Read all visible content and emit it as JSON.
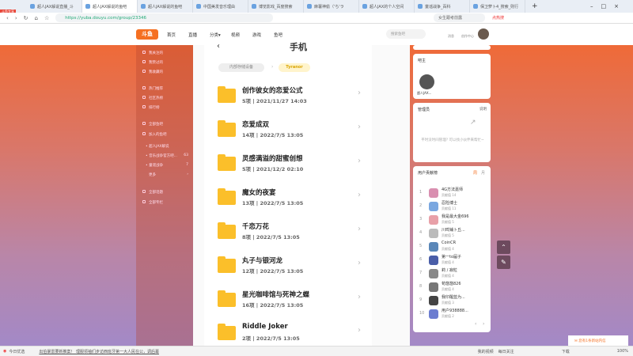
{
  "browser": {
    "tabs": [
      "超人JAX解说直播_斗",
      "超人JAX解说的鱼吧",
      "超人JAX解说的鱼吧",
      "中国美发音乐理由",
      "博览影戏_百度搜索",
      "麻薯神偷（'ち'ラ",
      "超人JAX的个人空间",
      "童谣战争_百科",
      "保卫萝卜4_搜索_则行"
    ],
    "url": "https://yuba.douyu.com/group/23346",
    "search_placeholder": "女生跟考前露",
    "hot_label": "点热搜",
    "badge": "斗鱼专享"
  },
  "site": {
    "logo": "斗鱼",
    "nav": [
      "首页",
      "直播",
      "分类▾",
      "视频",
      "游戏",
      "鱼吧"
    ],
    "search_placeholder": "搜索鱼吧",
    "header_icons": [
      "客户端",
      "消息",
      "创作中心"
    ]
  },
  "sidebar": {
    "items": [
      "我关注的",
      "我赞过的",
      "我收藏的",
      "热门推荐",
      "社区热榜",
      "排行榜",
      "全部鱼吧",
      "加入的鱼吧"
    ],
    "joined": [
      {
        "name": "超人JAX解说",
        "count": ""
      },
      {
        "name": "音乐战争官方吧...",
        "count": "63"
      },
      {
        "name": "童谣战争",
        "count": "7"
      },
      {
        "name": "更多",
        "count": "›"
      }
    ],
    "bottom": [
      "全部话题",
      "全部专栏"
    ]
  },
  "phone": {
    "top_label": "手机",
    "breadcrumb": [
      "内部存储设备",
      "Tyranor"
    ],
    "folders": [
      {
        "title": "创作彼女的恋爱公式",
        "meta": "5项 | 2021/11/27 14:03"
      },
      {
        "title": "恋爱成双",
        "meta": "14项 | 2022/7/5 13:05"
      },
      {
        "title": "灵感满溢的甜蜜创想",
        "meta": "5项 | 2021/12/2 02:10"
      },
      {
        "title": "魔女的夜宴",
        "meta": "13项 | 2022/7/5 13:05"
      },
      {
        "title": "千恋万花",
        "meta": "8项 | 2022/7/5 13:05"
      },
      {
        "title": "丸子与银河龙",
        "meta": "12项 | 2022/7/5 13:05"
      },
      {
        "title": "星光咖啡馆与死神之蝶",
        "meta": "16项 | 2022/7/5 13:05"
      },
      {
        "title": "Riddle Joker",
        "meta": "2项 | 2022/7/5 13:05"
      }
    ]
  },
  "right": {
    "owner_title": "吧主",
    "owner_name": "超人JAX...",
    "admin_title": "管理员",
    "admin_action": "说明",
    "admin_note": "平时没时间管理? 可以找小伙伴来帮忙~",
    "rank_title": "用户贡献榜",
    "rank_tabs": [
      "周",
      "月"
    ],
    "ranks": [
      {
        "n": "1",
        "name": "4G方法嘉师",
        "score": "贡献值 14"
      },
      {
        "n": "2",
        "name": "忍险博士",
        "score": "贡献值 11"
      },
      {
        "n": "3",
        "name": "我是最大金696",
        "score": "贡献值 5"
      },
      {
        "n": "4",
        "name": "川鸣铺卜丘...",
        "score": "贡献值 5"
      },
      {
        "n": "5",
        "name": "CoinCR",
        "score": "贡献值 4"
      },
      {
        "n": "6",
        "name": "第一to届子",
        "score": "贡献值 4"
      },
      {
        "n": "7",
        "name": "莉 / 寂粒",
        "score": "贡献值 4"
      },
      {
        "n": "8",
        "name": "苟悠悠826",
        "score": "贡献值 4"
      },
      {
        "n": "9",
        "name": "我印醒蓝为...",
        "score": "贡献值 3"
      },
      {
        "n": "10",
        "name": "用户938888...",
        "score": "贡献值 2"
      }
    ],
    "pager": [
      "‹",
      "›"
    ]
  },
  "float": {
    "notice": "您有1条新站内信"
  },
  "statusbar": {
    "left": "今日优选",
    "news": "出伯暴雷要新推案！ 理服领袖们步访西班牙第一大人民在公，调后幕",
    "right": [
      "我的视频",
      "每日关注",
      "下载"
    ],
    "zoom": "100%"
  }
}
